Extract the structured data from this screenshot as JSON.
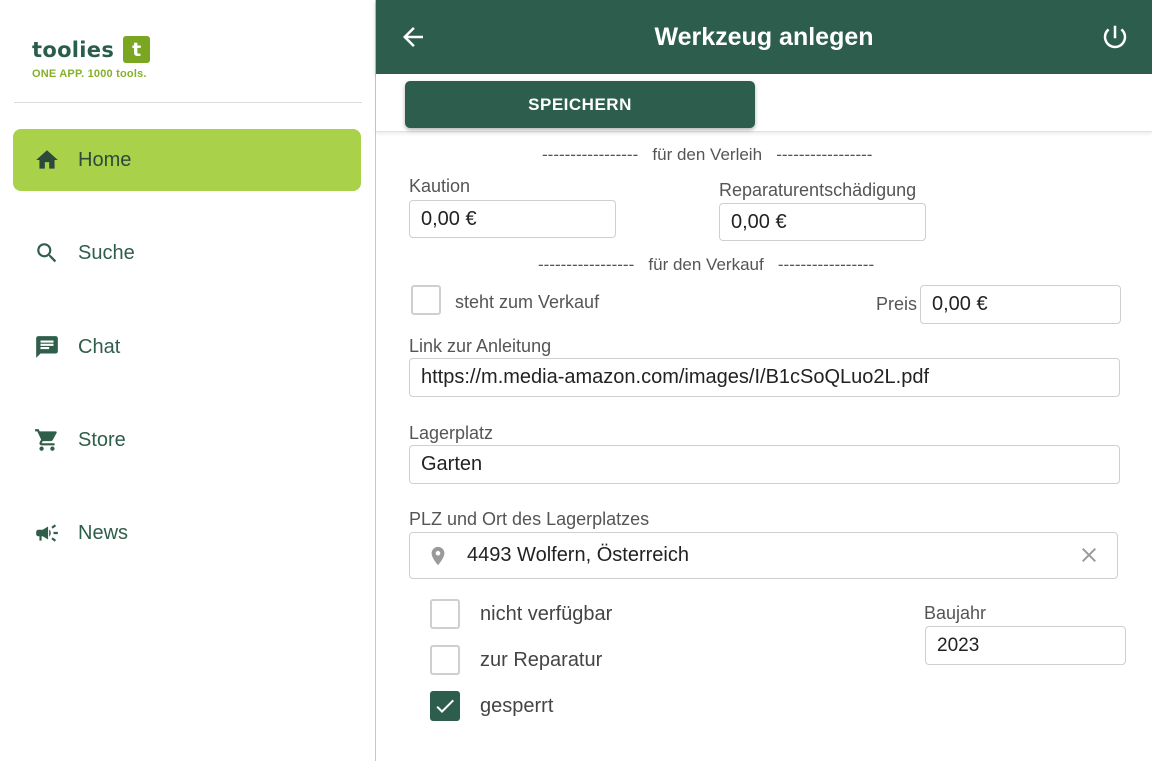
{
  "brand": {
    "name": "toolies",
    "badge": "t",
    "tagline": "ONE APP. 1000 tools."
  },
  "sidebar": {
    "items": [
      {
        "label": "Home",
        "icon": "home-icon",
        "active": true
      },
      {
        "label": "Suche",
        "icon": "search-icon",
        "active": false
      },
      {
        "label": "Chat",
        "icon": "chat-icon",
        "active": false
      },
      {
        "label": "Store",
        "icon": "cart-icon",
        "active": false
      },
      {
        "label": "News",
        "icon": "megaphone-icon",
        "active": false
      }
    ]
  },
  "header": {
    "title": "Werkzeug anlegen",
    "back_icon": "arrow-left-icon",
    "power_icon": "power-icon"
  },
  "toolbar": {
    "save_label": "SPEICHERN"
  },
  "form": {
    "rental_section": "-----------------   für den Verleih   -----------------",
    "deposit": {
      "label": "Kaution",
      "value": "0,00 €"
    },
    "repair_compensation": {
      "label": "Reparaturentschädigung",
      "value": "0,00 €"
    },
    "sale_section": "-----------------   für den Verkauf   -----------------",
    "for_sale": {
      "label": "steht zum Verkauf",
      "checked": false
    },
    "price": {
      "label": "Preis",
      "value": "0,00 €"
    },
    "manual_link": {
      "label": "Link zur Anleitung",
      "value": "https://m.media-amazon.com/images/I/B1cSoQLuo2L.pdf"
    },
    "storage": {
      "label": "Lagerplatz",
      "value": "Garten"
    },
    "location": {
      "label": "PLZ und Ort des Lagerplatzes",
      "value": "4493 Wolfern, Österreich"
    },
    "not_available": {
      "label": "nicht verfügbar",
      "checked": false
    },
    "in_repair": {
      "label": "zur Reparatur",
      "checked": false
    },
    "blocked": {
      "label": "gesperrt",
      "checked": true
    },
    "year": {
      "label": "Baujahr",
      "value": "2023"
    }
  },
  "colors": {
    "primary": "#2d5e4d",
    "active_nav": "#a9d14a",
    "logo_green": "#7aa621"
  }
}
